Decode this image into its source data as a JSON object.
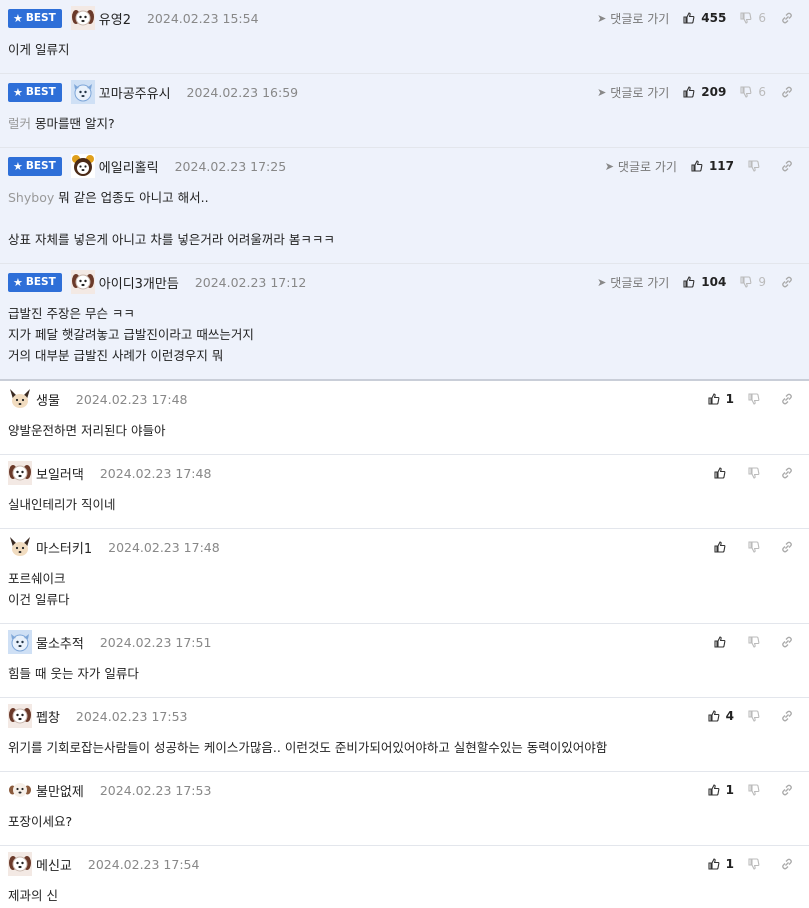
{
  "labels": {
    "best": "BEST",
    "go_to_reply": "댓글로 가기"
  },
  "comments": [
    {
      "best": true,
      "avatar": "dog-avatar",
      "nick": "유영2",
      "date": "2024.02.23 15:54",
      "likes": "455",
      "dislikes": "6",
      "go": true,
      "tag": "",
      "lines": [
        "이게 일류지"
      ]
    },
    {
      "best": true,
      "avatar": "blue-avatar",
      "nick": "꼬마공주유시",
      "date": "2024.02.23 16:59",
      "likes": "209",
      "dislikes": "6",
      "go": true,
      "tag": "럴커",
      "lines": [
        "몽마를땐 알지?"
      ]
    },
    {
      "best": true,
      "avatar": "bear-avatar",
      "nick": "에일리홀릭",
      "date": "2024.02.23 17:25",
      "likes": "117",
      "dislikes": "",
      "go": true,
      "tag": "Shyboy",
      "lines": [
        "뭐 같은 업종도 아니고 해서..",
        "",
        "상표 자체를 넣은게 아니고 차를 넣은거라 어려울꺼라 봄ㅋㅋㅋ"
      ]
    },
    {
      "best": true,
      "avatar": "dog-avatar",
      "nick": "아이디3개만듬",
      "date": "2024.02.23 17:12",
      "likes": "104",
      "dislikes": "9",
      "go": true,
      "tag": "",
      "lines": [
        "급발진 주장은 무슨 ㅋㅋ",
        "지가 페달 햇갈려놓고 급발진이라고 때쓰는거지",
        "거의 대부분 급발진 사례가 이런경우지 뭐"
      ]
    },
    {
      "best": false,
      "avatar": "fox-avatar",
      "nick": "생물",
      "date": "2024.02.23 17:48",
      "likes": "1",
      "dislikes": "",
      "go": false,
      "tag": "",
      "lines": [
        "양발운전하면 저리된다 야들아"
      ]
    },
    {
      "best": false,
      "avatar": "dog-avatar",
      "nick": "보일러댁",
      "date": "2024.02.23 17:48",
      "likes": "",
      "dislikes": "",
      "go": false,
      "tag": "",
      "lines": [
        "실내인테리가 직이네"
      ]
    },
    {
      "best": false,
      "avatar": "fox-avatar",
      "nick": "마스터키1",
      "date": "2024.02.23 17:48",
      "likes": "",
      "dislikes": "",
      "go": false,
      "tag": "",
      "lines": [
        "포르쉐이크",
        "이건 일류다"
      ]
    },
    {
      "best": false,
      "avatar": "blue-avatar",
      "nick": "물소추적",
      "date": "2024.02.23 17:51",
      "likes": "",
      "dislikes": "",
      "go": false,
      "tag": "",
      "lines": [
        "힘들 때 웃는 자가 일류다"
      ]
    },
    {
      "best": false,
      "avatar": "dog-avatar",
      "nick": "펩창",
      "date": "2024.02.23 17:53",
      "likes": "4",
      "dislikes": "",
      "go": false,
      "tag": "",
      "lines": [
        "위기를 기회로잡는사람들이 성공하는 케이스가많음.. 이런것도 준비가되어있어야하고 실현할수있는 동력이있어야함"
      ]
    },
    {
      "best": false,
      "avatar": "pup-avatar",
      "nick": "불만없제",
      "date": "2024.02.23 17:53",
      "likes": "1",
      "dislikes": "",
      "go": false,
      "tag": "",
      "lines": [
        "포장이세요?"
      ]
    },
    {
      "best": false,
      "avatar": "dog-avatar",
      "nick": "메신교",
      "date": "2024.02.23 17:54",
      "likes": "1",
      "dislikes": "",
      "go": false,
      "tag": "",
      "lines": [
        "제과의 신"
      ]
    }
  ]
}
